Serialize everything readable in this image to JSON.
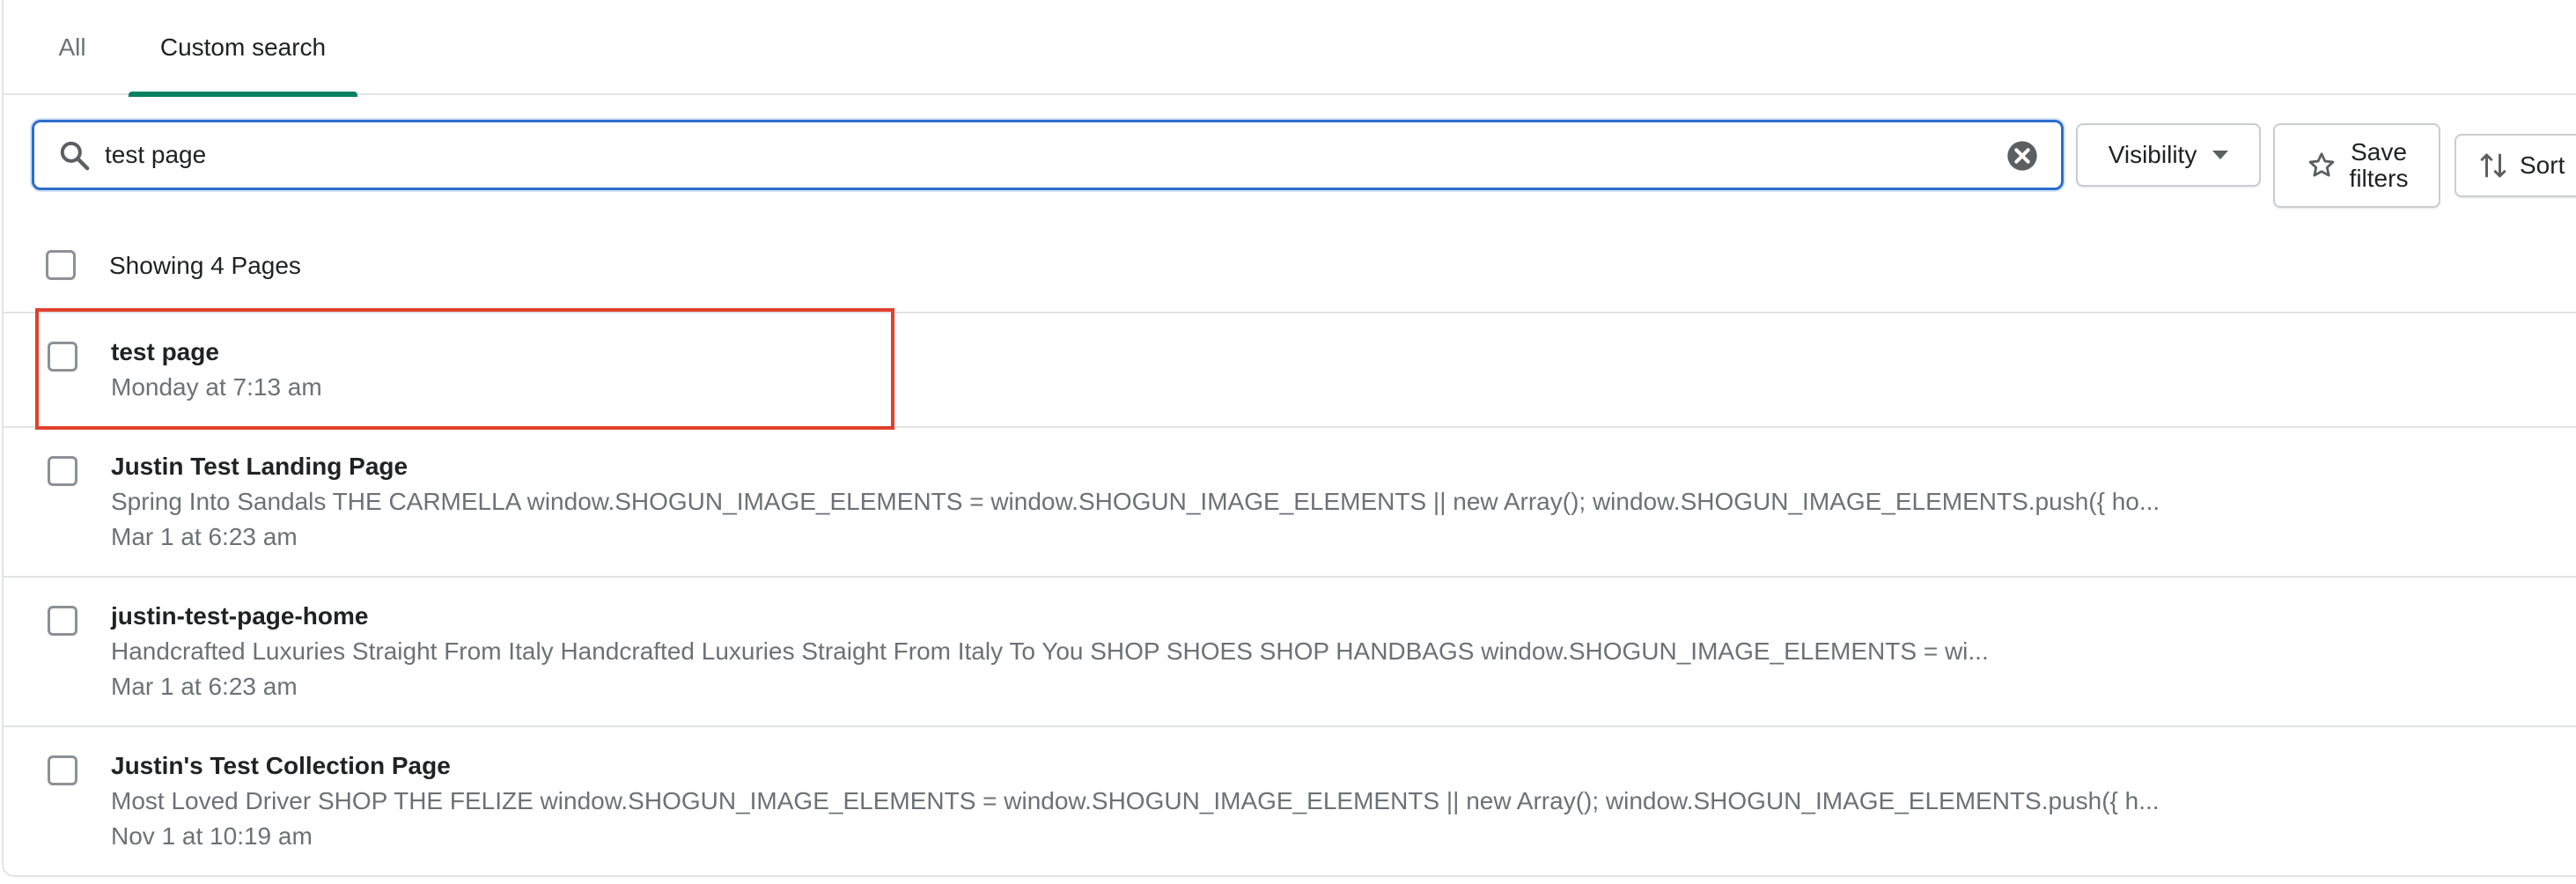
{
  "tabs": [
    {
      "label": "All",
      "selected": false
    },
    {
      "label": "Custom search",
      "selected": true
    }
  ],
  "search": {
    "value": "test page",
    "placeholder": "",
    "icon": "search-icon",
    "clear_icon": "clear-icon"
  },
  "filters": {
    "visibility_label": "Visibility",
    "save_label_line1": "Save",
    "save_label_line2": "filters",
    "sort_label": "Sort"
  },
  "list": {
    "header": "Showing 4 Pages",
    "rows": [
      {
        "title": "test page",
        "description": "",
        "date": "Monday at 7:13 am",
        "highlighted": true
      },
      {
        "title": "Justin Test Landing Page",
        "description": "Spring Into Sandals THE CARMELLA window.SHOGUN_IMAGE_ELEMENTS = window.SHOGUN_IMAGE_ELEMENTS || new Array(); window.SHOGUN_IMAGE_ELEMENTS.push({ ho...",
        "date": "Mar 1 at 6:23 am"
      },
      {
        "title": "justin-test-page-home",
        "description": "Handcrafted Luxuries Straight From Italy Handcrafted Luxuries Straight From Italy To You SHOP SHOES SHOP HANDBAGS window.SHOGUN_IMAGE_ELEMENTS = wi...",
        "date": "Mar 1 at 6:23 am"
      },
      {
        "title": "Justin's Test Collection Page",
        "description": "Most Loved Driver SHOP THE FELIZE window.SHOGUN_IMAGE_ELEMENTS = window.SHOGUN_IMAGE_ELEMENTS || new Array(); window.SHOGUN_IMAGE_ELEMENTS.push({ h...",
        "date": "Nov 1 at 10:19 am"
      }
    ]
  },
  "colors": {
    "accent_tab": "#008060",
    "focus_border": "#2c6ecb",
    "highlight": "#e0402c",
    "subdued_text": "#6d7175"
  }
}
